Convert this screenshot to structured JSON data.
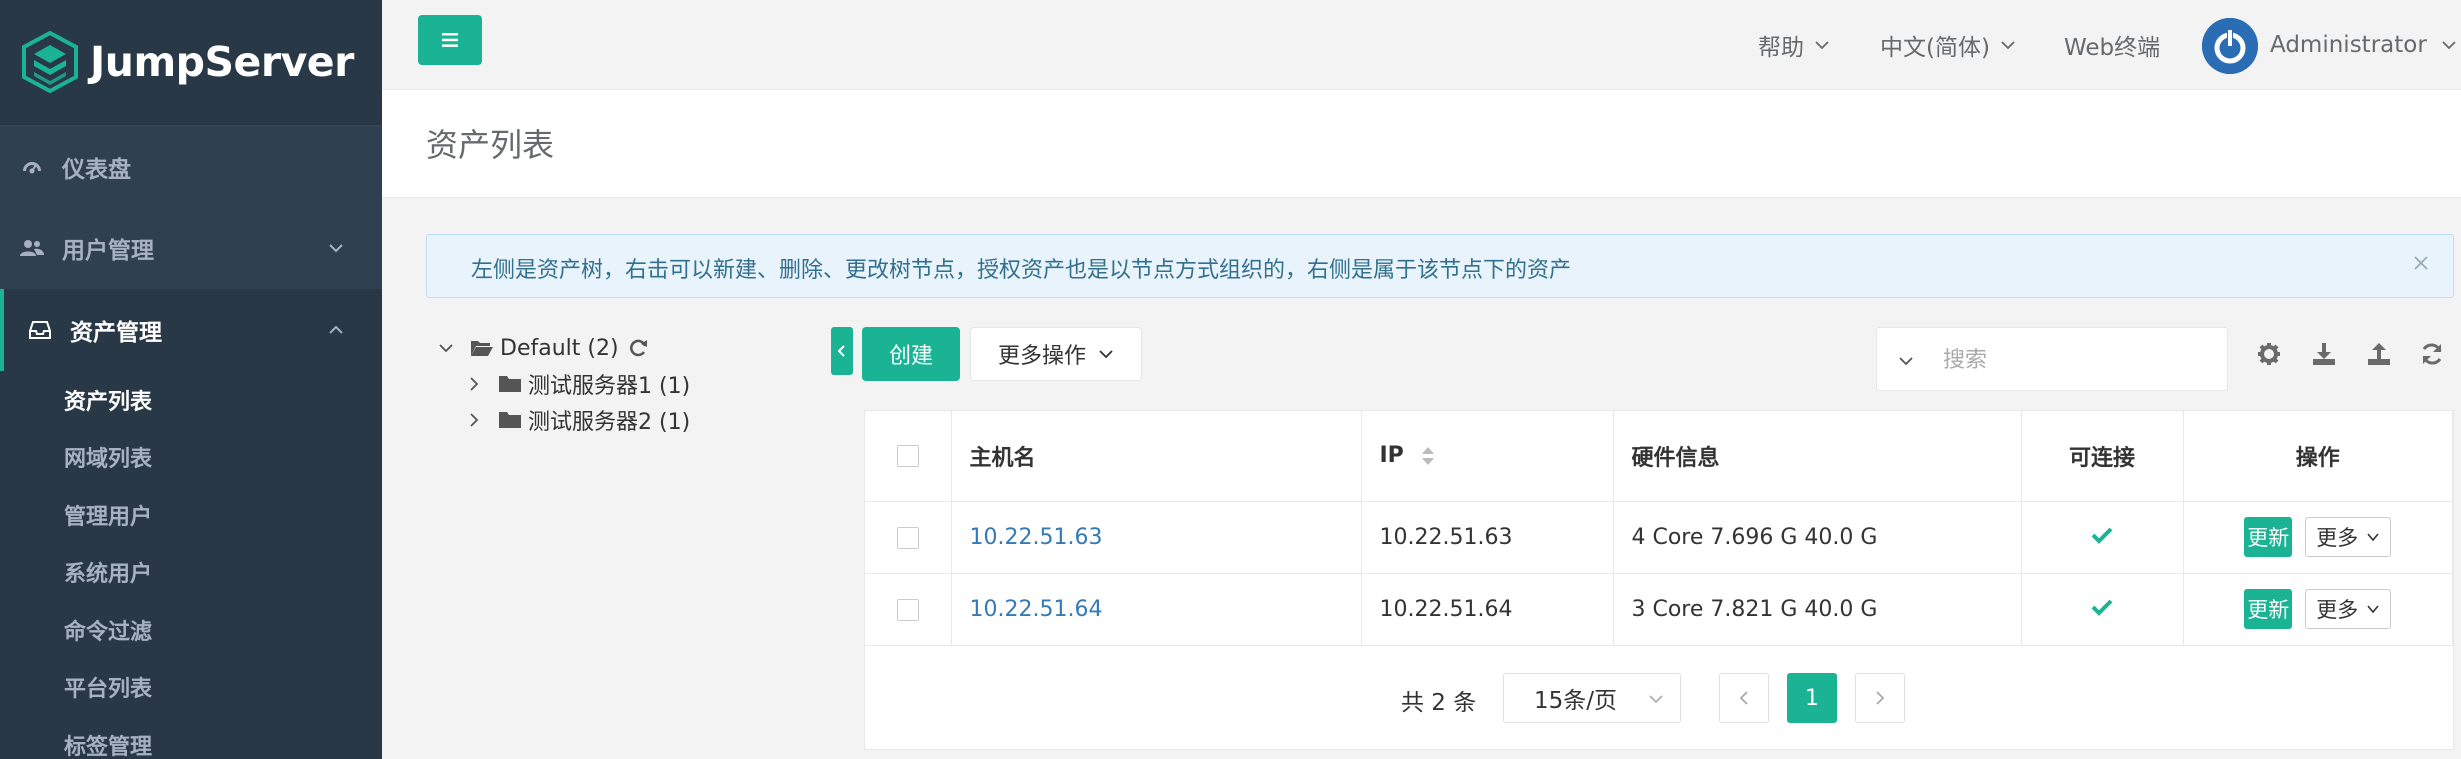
{
  "brand": {
    "name": "JumpServer"
  },
  "sidebar": {
    "items": [
      {
        "label": "仪表盘",
        "icon": "dashboard-icon"
      },
      {
        "label": "用户管理",
        "icon": "users-icon"
      },
      {
        "label": "资产管理",
        "icon": "inbox-icon"
      }
    ],
    "asset_subitems": [
      "资产列表",
      "网域列表",
      "管理用户",
      "系统用户",
      "命令过滤",
      "平台列表",
      "标签管理"
    ]
  },
  "topbar": {
    "help": "帮助",
    "language": "中文(简体)",
    "web_terminal": "Web终端",
    "user": "Administrator"
  },
  "page": {
    "title": "资产列表"
  },
  "alert": {
    "text": "左侧是资产树，右击可以新建、删除、更改树节点，授权资产也是以节点方式组织的，右侧是属于该节点下的资产"
  },
  "tree": {
    "root": "Default (2)",
    "children": [
      "测试服务器1 (1)",
      "测试服务器2 (1)"
    ]
  },
  "toolbar": {
    "create": "创建",
    "more_actions": "更多操作",
    "search_placeholder": "搜索"
  },
  "table": {
    "headers": {
      "hostname": "主机名",
      "ip": "IP",
      "hardware": "硬件信息",
      "connectable": "可连接",
      "actions": "操作"
    },
    "rows": [
      {
        "hostname": "10.22.51.63",
        "ip": "10.22.51.63",
        "hardware": "4 Core 7.696 G 40.0 G",
        "connectable": true
      },
      {
        "hostname": "10.22.51.64",
        "ip": "10.22.51.64",
        "hardware": "3 Core 7.821 G 40.0 G",
        "connectable": true
      }
    ],
    "update_label": "更新",
    "more_label": "更多"
  },
  "pagination": {
    "total": "共 2 条",
    "page_size": "15条/页",
    "current": "1"
  },
  "colors": {
    "primary": "#1ab394",
    "sidebar": "#2f4050",
    "link": "#337ab7"
  }
}
